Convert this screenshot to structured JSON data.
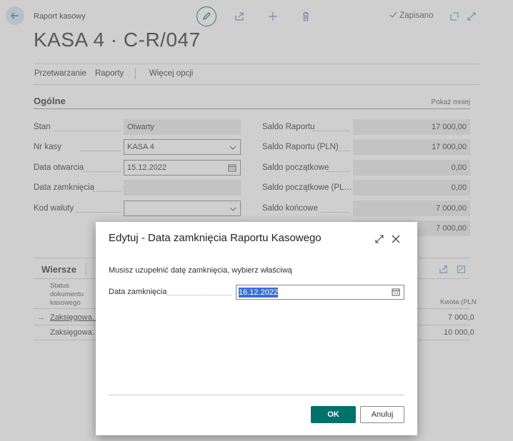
{
  "header": {
    "breadcrumb": "Raport kasowy",
    "title": "KASA 4 · C-R/047",
    "saved_status": "Zapisano",
    "icons": [
      "back-arrow-icon",
      "edit-icon",
      "share-icon",
      "add-icon",
      "delete-icon",
      "check-icon",
      "open-new-window-icon",
      "expand-icon"
    ]
  },
  "actions": {
    "items": [
      "Przetwarzanie",
      "Raporty",
      "Więcej opcji"
    ]
  },
  "general": {
    "title": "Ogólne",
    "show_less": "Pokaż mniej",
    "left_fields": [
      {
        "label": "Stan",
        "value": "Otwarty"
      },
      {
        "label": "Nr kasy",
        "value": "KASA 4"
      },
      {
        "label": "Data otwarcia",
        "value": "15.12.2022"
      },
      {
        "label": "Data zamknięcia",
        "value": ""
      },
      {
        "label": "Kod waluty",
        "value": ""
      }
    ],
    "right_fields": [
      {
        "label": "Saldo Raportu",
        "value": "17 000,00"
      },
      {
        "label": "Saldo Raportu (PLN)",
        "value": "17 000,00"
      },
      {
        "label": "Saldo początkowe",
        "value": "0,00"
      },
      {
        "label": "Saldo początkowe (PL…",
        "value": "0,00"
      },
      {
        "label": "Saldo końcowe",
        "value": "7 000,00"
      },
      {
        "label": "",
        "value": "7 000,00"
      }
    ]
  },
  "lines": {
    "title": "Wiersze",
    "col_status": "Status dokumentu kasowego",
    "col_amount": "Kwota (PLN",
    "rows": [
      {
        "status": "Zaksięgowa…",
        "amount": "7 000,0"
      },
      {
        "status": "Zaksięgowa…",
        "amount": "10 000,0"
      }
    ]
  },
  "dialog": {
    "title": "Edytuj - Data zamknięcia Raportu Kasowego",
    "message": "Musisz uzupełnić datę zamknięcia, wybierz właściwą",
    "field_label": "Data zamknięcia",
    "field_value": "16.12.2022",
    "ok_label": "OK",
    "cancel_label": "Anuluj"
  },
  "colors": {
    "accent": "#00716b",
    "selection": "#3a6fd8"
  }
}
